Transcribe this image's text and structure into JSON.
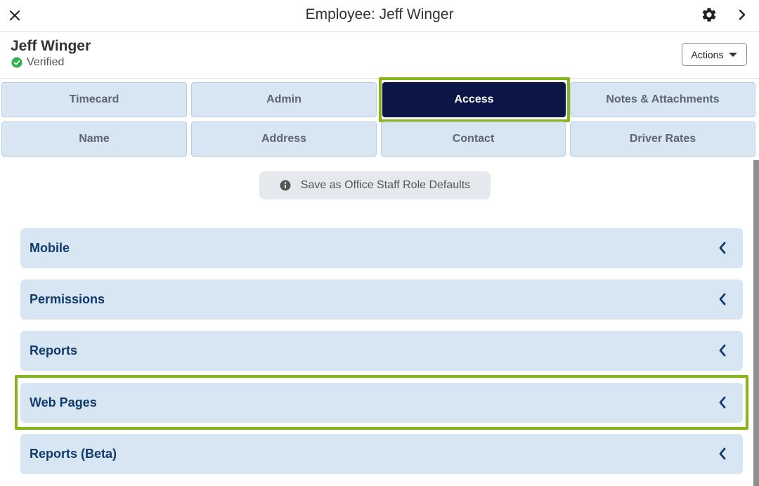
{
  "topbar": {
    "title": "Employee: Jeff Winger",
    "close_icon": "close-icon",
    "settings_icon": "gear-icon",
    "next_icon": "chevron-right-icon"
  },
  "employee": {
    "name": "Jeff Winger",
    "status": "Verified",
    "status_color": "#2bb24c",
    "actions_label": "Actions"
  },
  "tabs": {
    "row1": [
      "Timecard",
      "Admin",
      "Access",
      "Notes & Attachments"
    ],
    "row2": [
      "Name",
      "Address",
      "Contact",
      "Driver Rates"
    ],
    "active": "Access"
  },
  "save_defaults_label": "Save as Office Staff Role Defaults",
  "sections": [
    "Mobile",
    "Permissions",
    "Reports",
    "Web Pages",
    "Reports (Beta)"
  ],
  "colors": {
    "active_tab": "#0b1646",
    "tab_bg": "#d7e6f2",
    "highlight": "#86b61a",
    "section_text": "#0f3a6b"
  }
}
